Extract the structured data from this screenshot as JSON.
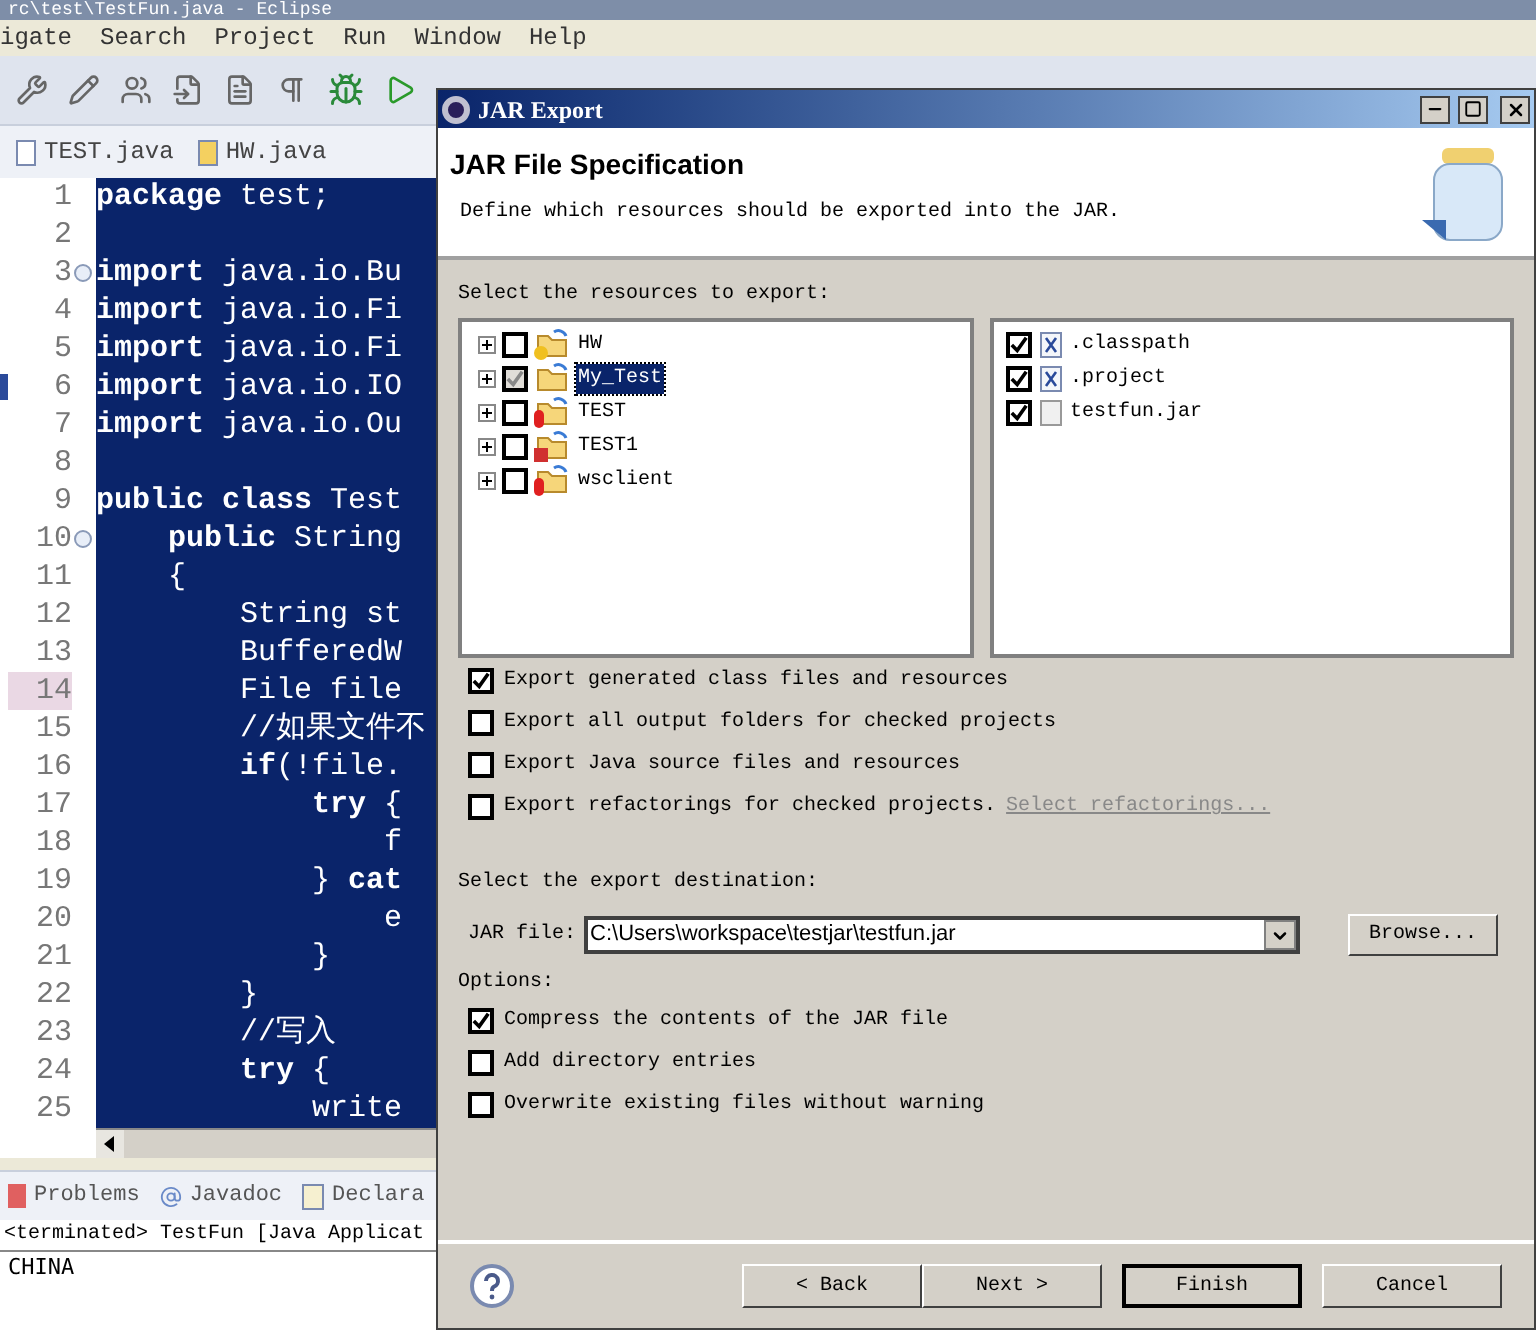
{
  "ide": {
    "title": "rc\\test\\TestFun.java - Eclipse",
    "menu": [
      "igate",
      "Search",
      "Project",
      "Run",
      "Window",
      "Help"
    ],
    "editor_tabs": [
      {
        "label": "TEST.java",
        "warning": false
      },
      {
        "label": "HW.java",
        "warning": true
      }
    ],
    "code_lines": [
      {
        "number": "1",
        "text": "**package** test;",
        "fold": false,
        "marker": false,
        "highlighted": false
      },
      {
        "number": "2",
        "fold": false,
        "marker": false,
        "highlighted": false
      },
      {
        "number": "3",
        "text": "**import** java.io.Bu",
        "fold": true,
        "marker": false,
        "highlighted": false
      },
      {
        "number": "4",
        "text": "**import** java.io.Fi",
        "fold": false,
        "marker": false,
        "highlighted": false
      },
      {
        "number": "5",
        "text": "**import** java.io.Fi",
        "fold": false,
        "marker": false,
        "highlighted": false
      },
      {
        "number": "6",
        "text": "**import** java.io.IO",
        "fold": false,
        "marker": true,
        "highlighted": false
      },
      {
        "number": "7",
        "text": "**import** java.io.Ou",
        "fold": false,
        "marker": false,
        "highlighted": false
      },
      {
        "number": "8",
        "fold": false,
        "marker": false,
        "highlighted": false
      },
      {
        "number": "9",
        "text": "**public class** Test",
        "fold": false,
        "marker": false,
        "highlighted": false
      },
      {
        "number": "10",
        "text": "    **public** String",
        "fold": true,
        "marker": false,
        "highlighted": false
      },
      {
        "number": "11",
        "text": "    {",
        "fold": false,
        "marker": false,
        "highlighted": false
      },
      {
        "number": "12",
        "text": "        String st",
        "fold": false,
        "marker": false,
        "highlighted": false
      },
      {
        "number": "13",
        "text": "        BufferedW",
        "fold": false,
        "marker": false,
        "highlighted": false
      },
      {
        "number": "14",
        "text": "        File file",
        "fold": false,
        "marker": false,
        "highlighted": true
      },
      {
        "number": "15",
        "text": "        //如果文件不",
        "fold": false,
        "marker": false,
        "highlighted": false
      },
      {
        "number": "16",
        "text": "        **if**(!file.",
        "fold": false,
        "marker": false,
        "highlighted": false
      },
      {
        "number": "17",
        "text": "            **try** {",
        "fold": false,
        "marker": false,
        "highlighted": false
      },
      {
        "number": "18",
        "text": "                f",
        "fold": false,
        "marker": false,
        "highlighted": false
      },
      {
        "number": "19",
        "text": "            } **cat**",
        "fold": false,
        "marker": false,
        "highlighted": false
      },
      {
        "number": "20",
        "text": "                e",
        "fold": false,
        "marker": false,
        "highlighted": false
      },
      {
        "number": "21",
        "text": "            }",
        "fold": false,
        "marker": false,
        "highlighted": false
      },
      {
        "number": "22",
        "text": "        }",
        "fold": false,
        "marker": false,
        "highlighted": false
      },
      {
        "number": "23",
        "text": "        //写入",
        "fold": false,
        "marker": false,
        "highlighted": false
      },
      {
        "number": "24",
        "text": "        **try** {",
        "fold": false,
        "marker": false,
        "highlighted": false
      },
      {
        "number": "25",
        "text": "            write",
        "fold": false,
        "marker": false,
        "highlighted": false
      }
    ],
    "view_tabs": [
      {
        "label": "Problems",
        "kind": "problems"
      },
      {
        "label": "Javadoc",
        "kind": "javadoc"
      },
      {
        "label": "Declara",
        "kind": "declaration"
      }
    ],
    "console_header": "<terminated> TestFun [Java Applicat",
    "console_output": "CHINA"
  },
  "dialog": {
    "title": "JAR Export",
    "heading": "JAR File Specification",
    "description": "Define which resources should be exported into the JAR.",
    "resources_label": "Select the resources to export:",
    "projects": [
      {
        "name": "HW",
        "checked": false,
        "grayed": false,
        "selected": false,
        "kind": "warning"
      },
      {
        "name": "My_Test",
        "checked": true,
        "grayed": true,
        "selected": true,
        "kind": "plain"
      },
      {
        "name": "TEST",
        "checked": false,
        "grayed": false,
        "selected": false,
        "kind": "error"
      },
      {
        "name": "TEST1",
        "checked": false,
        "grayed": false,
        "selected": false,
        "kind": "failed"
      },
      {
        "name": "wsclient",
        "checked": false,
        "grayed": false,
        "selected": false,
        "kind": "error"
      }
    ],
    "files": [
      {
        "name": ".classpath",
        "checked": true,
        "kind": "xml"
      },
      {
        "name": ".project",
        "checked": true,
        "kind": "xml"
      },
      {
        "name": "testfun.jar",
        "checked": true,
        "kind": "jar"
      }
    ],
    "export_options": [
      {
        "label": "Export generated class files and resources",
        "checked": true
      },
      {
        "label": "Export all output folders for checked projects",
        "checked": false
      },
      {
        "label": "Export Java source files and resources",
        "checked": false
      },
      {
        "label": "Export refactorings for checked projects.",
        "checked": false,
        "link": "Select refactorings..."
      }
    ],
    "destination_label": "Select the export destination:",
    "jar_file_label": "JAR file:",
    "jar_file_value": "C:\\Users\\workspace\\testjar\\testfun.jar",
    "browse": "Browse...",
    "options_label": "Options:",
    "options": [
      {
        "label": "Compress the contents of the JAR file",
        "checked": true
      },
      {
        "label": "Add directory entries",
        "checked": false
      },
      {
        "label": "Overwrite existing files without warning",
        "checked": false
      }
    ],
    "buttons": [
      {
        "label": "< Back",
        "default": false
      },
      {
        "label": "Next >",
        "default": false
      },
      {
        "label": "Finish",
        "default": true
      },
      {
        "label": "Cancel",
        "default": false
      }
    ]
  }
}
